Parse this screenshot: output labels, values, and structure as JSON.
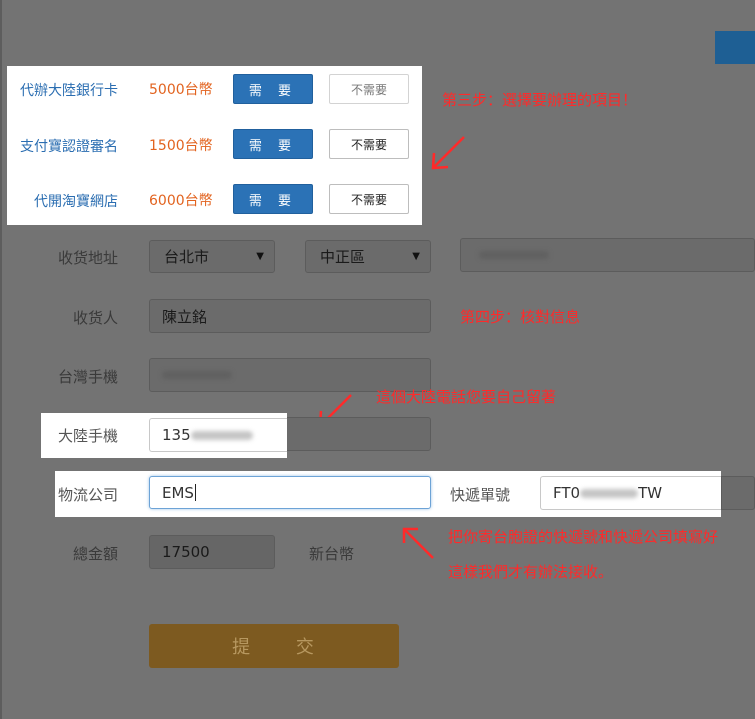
{
  "services": [
    {
      "label": "代辦大陸銀行卡",
      "price": "5000台幣",
      "need": "需 要",
      "no_need": "不需要"
    },
    {
      "label": "支付寶認證審名",
      "price": "1500台幣",
      "need": "需 要",
      "no_need": "不需要"
    },
    {
      "label": "代開淘寶網店",
      "price": "6000台幣",
      "need": "需 要",
      "no_need": "不需要"
    }
  ],
  "form": {
    "address_label": "收货地址",
    "city_value": "台北市",
    "district_value": "中正區",
    "recipient_label": "收货人",
    "recipient_value": "陳立銘",
    "tw_phone_label": "台灣手機",
    "cn_phone_label": "大陸手機",
    "cn_phone_value": "135",
    "logistics_label": "物流公司",
    "logistics_value": "EMS",
    "tracking_label": "快遞單號",
    "tracking_prefix": "FT0",
    "tracking_suffix": "TW",
    "total_label": "總金額",
    "total_value": "17500",
    "total_unit": "新台幣",
    "submit_label": "提 交"
  },
  "annotations": {
    "step3": "第三步：選擇要辦理的項目！",
    "step4": "第四步：核對信息",
    "phone_note": "這個大陸電話您要自己留著",
    "tracking_note_line1": "把你寄台胞證的快遞號和快遞公司填寫好",
    "tracking_note_line2": "這樣我們才有辦法接收。"
  },
  "colors": {
    "overlay": "#737373",
    "primary_button": "#2b72b6",
    "price": "#e2631f",
    "annotation": "#ff2a2a",
    "submit": "#7d5a20"
  }
}
